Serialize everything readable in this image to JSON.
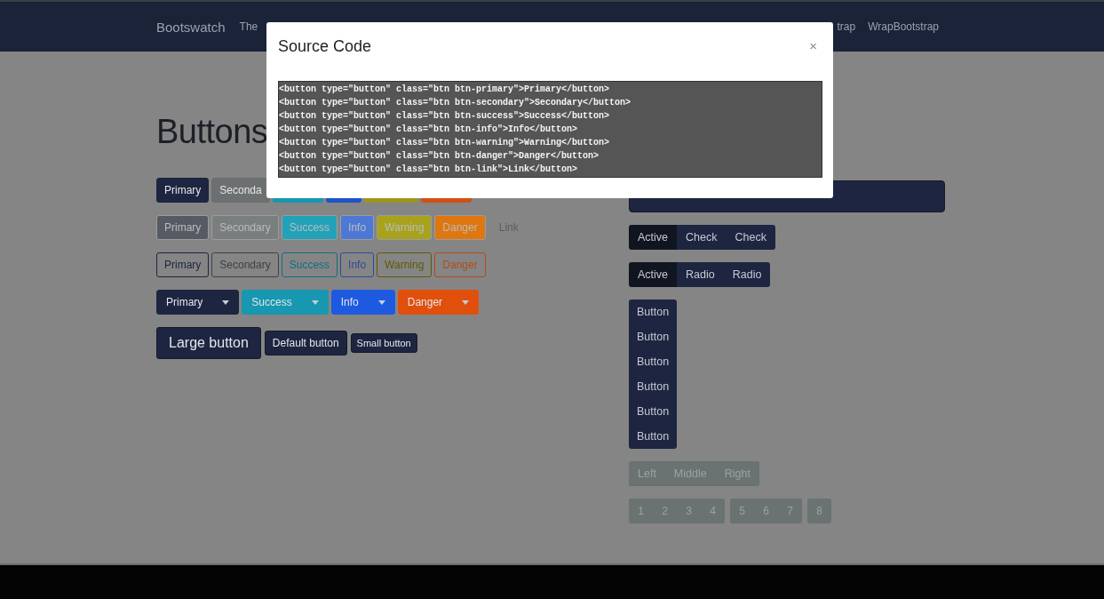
{
  "navbar": {
    "brand": "Bootswatch",
    "items": [
      "The",
      "trap",
      "WrapBootstrap"
    ]
  },
  "heading": "Buttons",
  "button_rows": [
    {
      "kind": "solid",
      "disabled": false,
      "items": [
        {
          "label": "Primary",
          "color": "#1d2540"
        },
        {
          "label": "Seconda",
          "color": "#6c7070"
        },
        {
          "color": "#1797b0"
        },
        {
          "color": "#1f54c8"
        },
        {
          "color": "#9c961a"
        },
        {
          "color": "#d24f12"
        }
      ]
    },
    {
      "kind": "solid",
      "disabled": true,
      "items": [
        {
          "label": "Primary",
          "color": "#565b63"
        },
        {
          "label": "Secondary",
          "color": "#7a7e7e"
        },
        {
          "label": "Success",
          "color": "#22a2b8"
        },
        {
          "label": "Info",
          "color": "#4e78d6"
        },
        {
          "label": "Warning",
          "color": "#a8a21c"
        },
        {
          "label": "Danger",
          "color": "#e0760e"
        }
      ],
      "link": "Link"
    },
    {
      "kind": "outline",
      "disabled": false,
      "items": [
        {
          "label": "Primary",
          "color": "#1d2540"
        },
        {
          "label": "Secondary",
          "color": "#3e4242"
        },
        {
          "label": "Success",
          "color": "#0e6f82"
        },
        {
          "label": "Info",
          "color": "#2c4a9a"
        },
        {
          "label": "Warning",
          "color": "#5e5a04"
        },
        {
          "label": "Danger",
          "color": "#b44a1a"
        }
      ]
    },
    {
      "kind": "split",
      "disabled": false,
      "items": [
        {
          "label": "Primary",
          "color": "#1d2540"
        },
        {
          "label": "Success",
          "color": "#1797b0"
        },
        {
          "label": "Info",
          "color": "#1d5ae0"
        },
        {
          "label": "Danger",
          "color": "#e0500c"
        }
      ]
    }
  ],
  "size_buttons": [
    {
      "label": "Large button",
      "kind": "large"
    },
    {
      "label": "Default button",
      "kind": "default"
    },
    {
      "label": "Small button",
      "kind": "small"
    }
  ],
  "block_button": {
    "kind": "block"
  },
  "check_group": [
    {
      "label": "Active",
      "selected": true
    },
    {
      "label": "Check",
      "selected": false
    },
    {
      "label": "Check",
      "selected": false
    }
  ],
  "radio_group": [
    {
      "label": "Active",
      "selected": true
    },
    {
      "label": "Radio",
      "selected": false
    },
    {
      "label": "Radio",
      "selected": false
    }
  ],
  "vertical_group": [
    "Button",
    "Button",
    "Button",
    "Button",
    "Button",
    "Button"
  ],
  "segmented": {
    "disabled": true,
    "items": [
      "Left",
      "Middle",
      "Right"
    ]
  },
  "pagination": [
    [
      "1",
      "2",
      "3",
      "4"
    ],
    [
      "5",
      "6",
      "7"
    ],
    [
      "8"
    ]
  ],
  "modal": {
    "title": "Source Code",
    "close": "×",
    "code": [
      "<button type=\"button\" class=\"btn btn-primary\">Primary</button>",
      "<button type=\"button\" class=\"btn btn-secondary\">Secondary</button>",
      "<button type=\"button\" class=\"btn btn-success\">Success</button>",
      "<button type=\"button\" class=\"btn btn-info\">Info</button>",
      "<button type=\"button\" class=\"btn btn-warning\">Warning</button>",
      "<button type=\"button\" class=\"btn btn-danger\">Danger</button>",
      "<button type=\"button\" class=\"btn btn-link\">Link</button>"
    ]
  }
}
